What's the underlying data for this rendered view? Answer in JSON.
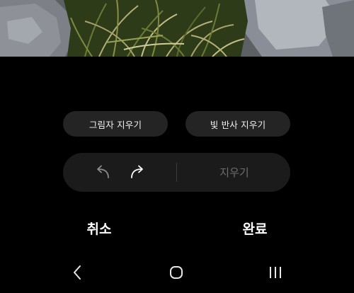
{
  "photo": {
    "colors": {
      "rock": "#7d8087",
      "rock_light": "#a9adb4",
      "grass_dark": "#2d3b18",
      "grass_mid": "#6b7a35",
      "grass_light": "#b5b07a"
    }
  },
  "chips": {
    "shadow_label": "그림자 지우기",
    "reflection_label": "빛 반사 지우기"
  },
  "toolbar": {
    "undo_icon": "undo-arrow-icon",
    "redo_icon": "redo-arrow-icon",
    "erase_label": "지우기"
  },
  "actions": {
    "cancel_label": "취소",
    "done_label": "완료"
  },
  "navbar": {
    "back_icon": "chevron-left-icon",
    "home_icon": "home-rounded-square-icon",
    "recents_icon": "recents-bars-icon"
  },
  "colors": {
    "background": "#000000",
    "chip_background": "#242424",
    "toolbar_background": "#1b1b1b",
    "disabled_text": "#6e6e6e",
    "text": "#ffffff"
  }
}
